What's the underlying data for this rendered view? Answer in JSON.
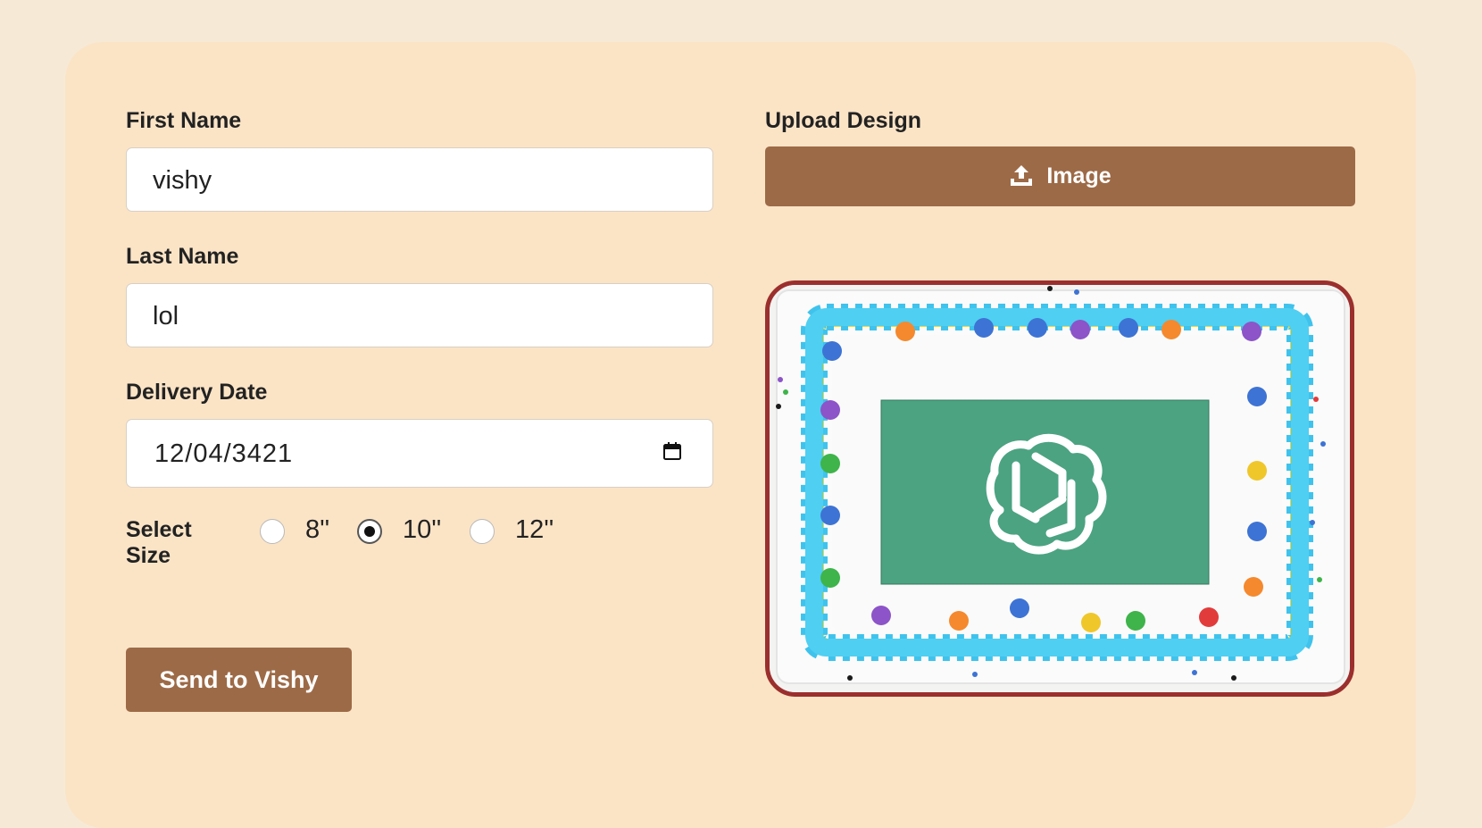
{
  "form": {
    "first_name": {
      "label": "First Name",
      "value": "vishy"
    },
    "last_name": {
      "label": "Last Name",
      "value": "lol"
    },
    "delivery_date": {
      "label": "Delivery Date",
      "value": "12/04/3421"
    },
    "size": {
      "label": "Select Size",
      "options": [
        "8''",
        "10''",
        "12''"
      ],
      "selected": "10''"
    },
    "submit_label": "Send to Vishy"
  },
  "upload": {
    "label": "Upload Design",
    "button_label": "Image",
    "button_icon": "upload-icon"
  },
  "preview": {
    "image": "cake-preview",
    "logo_icon": "openai-logo-icon"
  },
  "colors": {
    "page_bg": "#f6ead7",
    "card_bg": "#fbe4c6",
    "button": "#9d6a47",
    "preview_border": "#9b2f2e",
    "logo_bg": "#4ba382"
  }
}
